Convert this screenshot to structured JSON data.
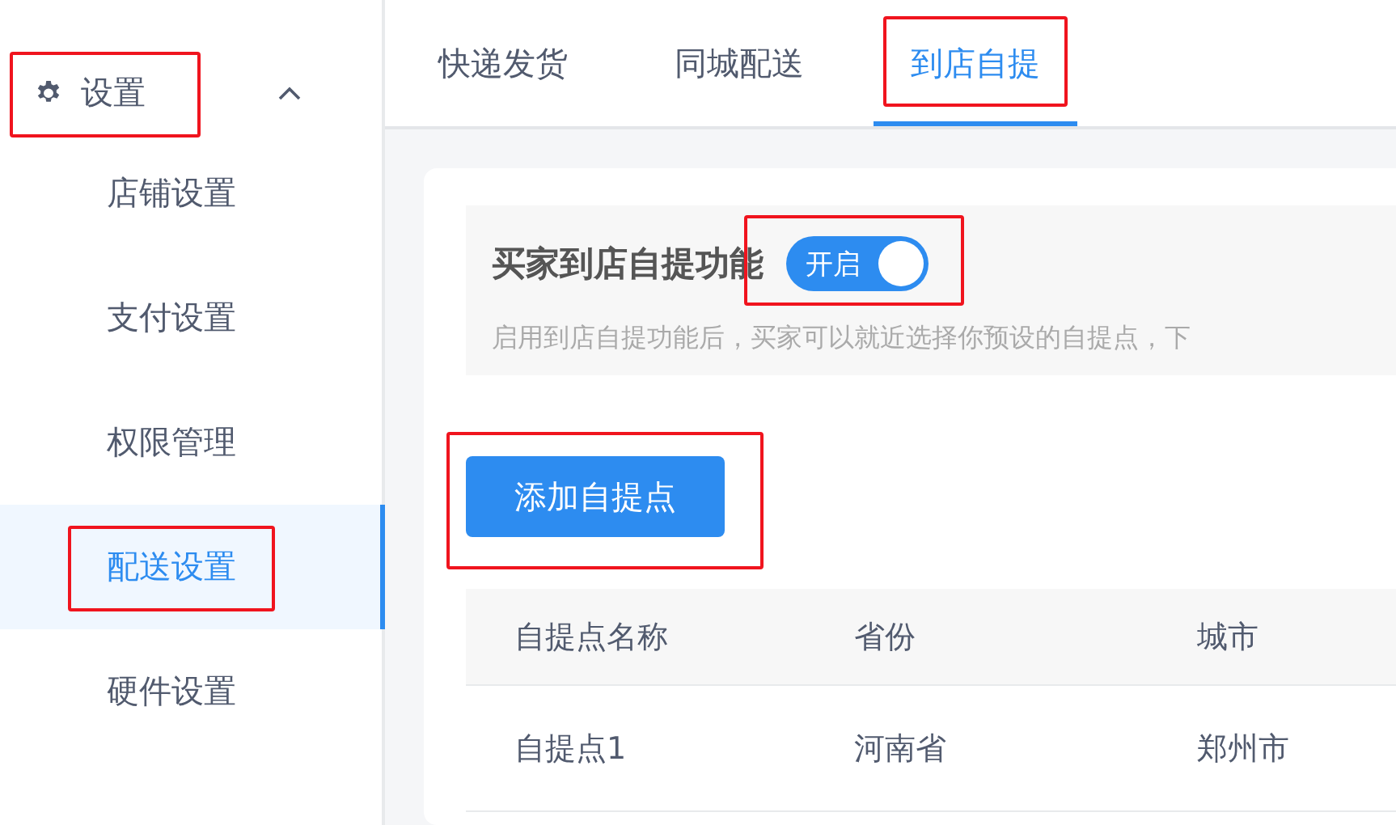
{
  "sidebar": {
    "group": {
      "label": "设置",
      "expanded": true,
      "annotated": true
    },
    "items": [
      {
        "label": "店铺设置",
        "selected": false,
        "annotated": false
      },
      {
        "label": "支付设置",
        "selected": false,
        "annotated": false
      },
      {
        "label": "权限管理",
        "selected": false,
        "annotated": false
      },
      {
        "label": "配送设置",
        "selected": true,
        "annotated": true
      },
      {
        "label": "硬件设置",
        "selected": false,
        "annotated": false
      }
    ]
  },
  "tabs": [
    {
      "label": "快递发货",
      "selected": false,
      "annotated": false
    },
    {
      "label": "同城配送",
      "selected": false,
      "annotated": false
    },
    {
      "label": "到店自提",
      "selected": true,
      "annotated": true
    }
  ],
  "pickup_panel": {
    "title": "买家到店自提功能",
    "toggle": {
      "label": "开启",
      "on": true,
      "annotated": true
    },
    "description": "启用到店自提功能后，买家可以就近选择你预设的自提点，下"
  },
  "add_button": {
    "label": "添加自提点",
    "annotated": true
  },
  "table": {
    "columns": [
      "自提点名称",
      "省份",
      "城市"
    ],
    "rows": [
      [
        "自提点1",
        "河南省",
        "郑州市"
      ]
    ]
  }
}
